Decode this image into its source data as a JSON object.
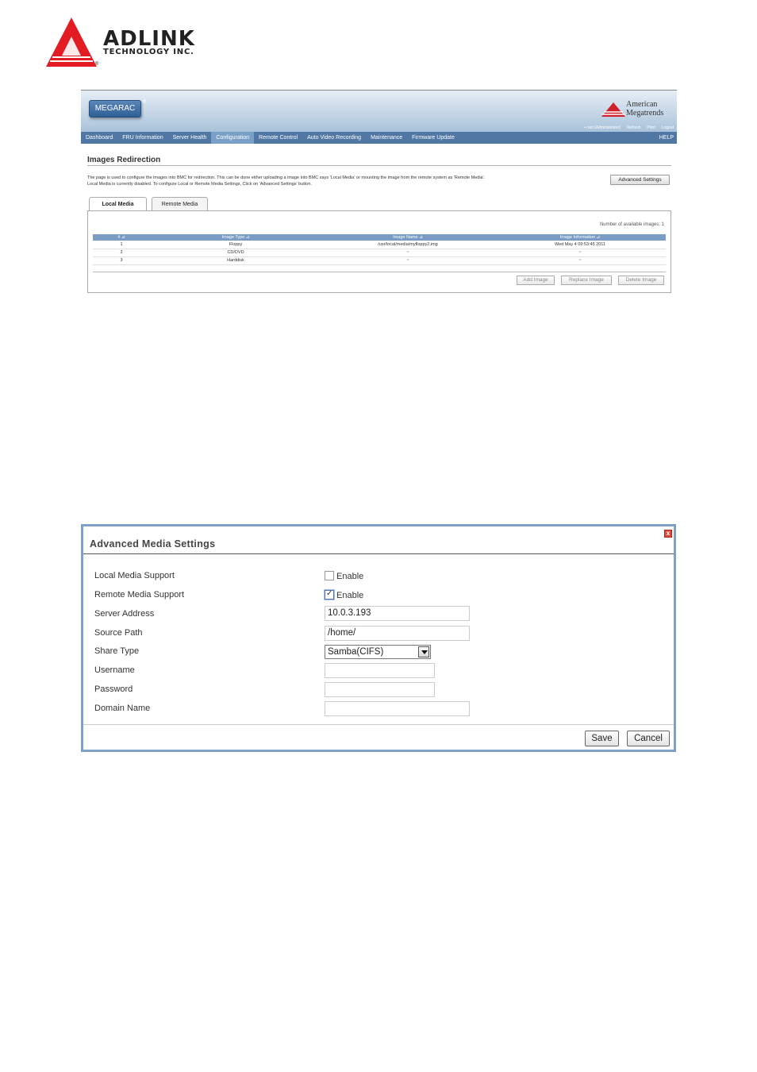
{
  "logo": {
    "name": "ADLINK",
    "subtitle": "TECHNOLOGY INC.",
    "registered": "®",
    "color": "#e31b23"
  },
  "images_redirection": {
    "brand": "MEGARAC",
    "brand_registered": "®",
    "vendor_line1": "American",
    "vendor_line2": "Megatrends",
    "user_links": [
      "• root (Administrator)",
      "Refresh",
      "Print",
      "Logout"
    ],
    "nav": [
      "Dashboard",
      "FRU Information",
      "Server Health",
      "Configuration",
      "Remote Control",
      "Auto Video Recording",
      "Maintenance",
      "Firmware Update"
    ],
    "nav_active": "Configuration",
    "help": "HELP",
    "title": "Images Redirection",
    "description_line1": "The page is used to configure the images into BMC for redirection. This can be done either uploading a image into BMC says 'Local Media' or mounting the image from the remote system as 'Remote Media'.",
    "description_line2": "Local Media is currently disabled. To configure Local or Remote Media Settings, Click on 'Advanced Settings' button.",
    "advanced_button": "Advanced Settings",
    "tabs": [
      "Local Media",
      "Remote Media"
    ],
    "available": "Number of available images: 1",
    "columns": [
      "# ⊿",
      "Image Type ⊿",
      "Image Name ⊿",
      "Image Information ⊿"
    ],
    "rows": [
      [
        "1",
        "Floppy",
        "/usr/local/media/myfloppy2.img",
        "Wed May 4 09:53:45 2011"
      ],
      [
        "2",
        "CD/DVD",
        "~",
        "~"
      ],
      [
        "3",
        "Harddisk",
        "~",
        "~"
      ]
    ],
    "buttons": [
      "Add Image",
      "Replace Image",
      "Delete Image"
    ]
  },
  "advanced_media": {
    "title": "Advanced Media Settings",
    "close": "x",
    "labels": {
      "local_media": "Local Media Support",
      "remote_media": "Remote Media Support",
      "server_address": "Server Address",
      "source_path": "Source Path",
      "share_type": "Share Type",
      "username": "Username",
      "password": "Password",
      "domain_name": "Domain Name"
    },
    "enable_text": "Enable",
    "local_enabled": false,
    "remote_enabled": true,
    "checkmark": "✓",
    "values": {
      "server_address": "10.0.3.193",
      "source_path": "/home/",
      "share_type": "Samba(CIFS)",
      "username": "",
      "password": "",
      "domain_name": ""
    },
    "buttons": {
      "save": "Save",
      "cancel": "Cancel"
    }
  }
}
